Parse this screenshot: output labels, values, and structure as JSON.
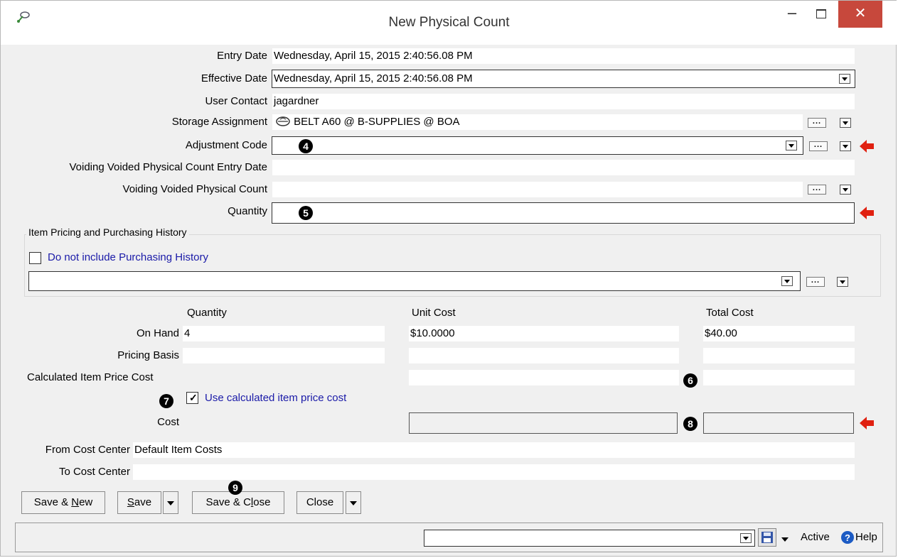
{
  "window": {
    "title": "New Physical Count"
  },
  "form": {
    "entry_date": {
      "label": "Entry Date",
      "value": "Wednesday, April 15, 2015 2:40:56.08 PM"
    },
    "effective_date": {
      "label": "Effective Date",
      "value": "Wednesday, April 15, 2015 2:40:56.08 PM"
    },
    "user_contact": {
      "label": "User Contact",
      "value": "jagardner"
    },
    "storage_assignment": {
      "label": "Storage Assignment",
      "value": "BELT A60 @ B-SUPPLIES @ BOA"
    },
    "adjustment_code": {
      "label": "Adjustment Code",
      "value": ""
    },
    "voiding_entry_date": {
      "label": "Voiding Voided Physical Count Entry Date",
      "value": ""
    },
    "voiding_count": {
      "label": "Voiding Voided Physical Count",
      "value": ""
    },
    "quantity": {
      "label": "Quantity",
      "value": ""
    }
  },
  "pricing_group": {
    "title": "Item Pricing and Purchasing History",
    "checkbox_label": "Do not include Purchasing History",
    "checkbox_checked": false,
    "select_value": ""
  },
  "costs": {
    "headers": {
      "quantity": "Quantity",
      "unit_cost": "Unit Cost",
      "total_cost": "Total Cost"
    },
    "on_hand": {
      "label": "On Hand",
      "quantity": "4",
      "unit_cost": "$10.0000",
      "total_cost": "$40.00"
    },
    "pricing_basis": {
      "label": "Pricing Basis",
      "quantity": "",
      "unit_cost": "",
      "total_cost": ""
    },
    "calculated": {
      "label": "Calculated Item Price Cost",
      "unit_cost": "",
      "total_cost": ""
    },
    "use_calculated": {
      "label": "Use calculated item price cost",
      "checked": true
    },
    "cost": {
      "label": "Cost"
    }
  },
  "cost_centers": {
    "from": {
      "label": "From Cost Center",
      "value": "Default Item Costs"
    },
    "to": {
      "label": "To Cost Center",
      "value": ""
    }
  },
  "buttons": {
    "save_new_pre": "Save & ",
    "save_new_u": "N",
    "save_new_post": "ew",
    "save_u": "S",
    "save_post": "ave",
    "save_close_pre": "Save & C",
    "save_close_u": "l",
    "save_close_post": "ose",
    "close": "Close"
  },
  "badges": [
    "4",
    "5",
    "6",
    "7",
    "8",
    "9"
  ],
  "status_bar": {
    "active": "Active",
    "help": "Help"
  },
  "colors": {
    "close_button": "#c7483c",
    "arrow": "#e02010",
    "link_blue": "#1a1aa8"
  }
}
